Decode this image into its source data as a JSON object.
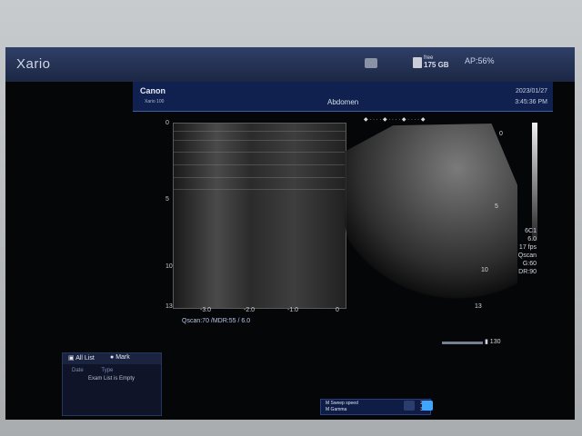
{
  "window": {
    "brand": "Xario",
    "ap": "AP:56%"
  },
  "storage": {
    "label": "free",
    "value": "175 GB"
  },
  "header": {
    "logo": "Canon",
    "model": "Xario 100",
    "preset": "Abdomen",
    "date": "2023/01/27",
    "time": "3:45:36 PM"
  },
  "mmode": {
    "depth_labels": [
      "0",
      "5",
      "10",
      "13"
    ],
    "x_labels": [
      "-3.0",
      "-2.0",
      "-1.0",
      "0"
    ],
    "footer": "Qscan:70   /MDR:55 / 6.0"
  },
  "bmode": {
    "top_scale": "0",
    "depth_5": "5",
    "depth_10": "10",
    "bottom_depth": "13",
    "probe": "6C1",
    "freq": "6.0",
    "fps": "17 fps",
    "qscan": "Qscan",
    "gain": "G:60",
    "dr": "DR:90",
    "scroll_marker": "130"
  },
  "examlist": {
    "tab_all": "All List",
    "tab_mark": "Mark",
    "col_date": "Date",
    "col_type": "Type",
    "empty_text": "Exam List is Empty"
  },
  "bottom": {
    "label1": "M Sweep speed",
    "value1": "2",
    "label2": "M Gamma",
    "value2": "3"
  }
}
